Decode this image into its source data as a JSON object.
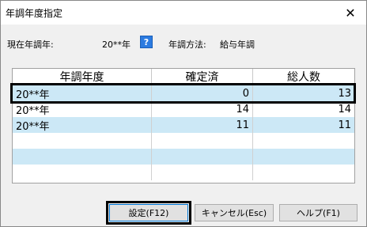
{
  "window": {
    "title": "年調年度指定",
    "close_glyph": "✕"
  },
  "info": {
    "current_year_label": "現在年調年:",
    "current_year_value": "20**年",
    "help_glyph": "?",
    "method_label": "年調方法:",
    "method_value": "給与年調"
  },
  "table": {
    "columns": [
      "年調年度",
      "確定済",
      "総人数"
    ],
    "rows": [
      {
        "year": "20**年",
        "confirmed": "0",
        "total": "13"
      },
      {
        "year": "20**年",
        "confirmed": "14",
        "total": "14"
      },
      {
        "year": "20**年",
        "confirmed": "11",
        "total": "11"
      }
    ]
  },
  "buttons": {
    "settings": "設定(F12)",
    "cancel": "キャンセル(Esc)",
    "help": "ヘルプ(F1)"
  },
  "colors": {
    "row_blue": "#cce8f6",
    "help_icon": "#2c7be0"
  }
}
